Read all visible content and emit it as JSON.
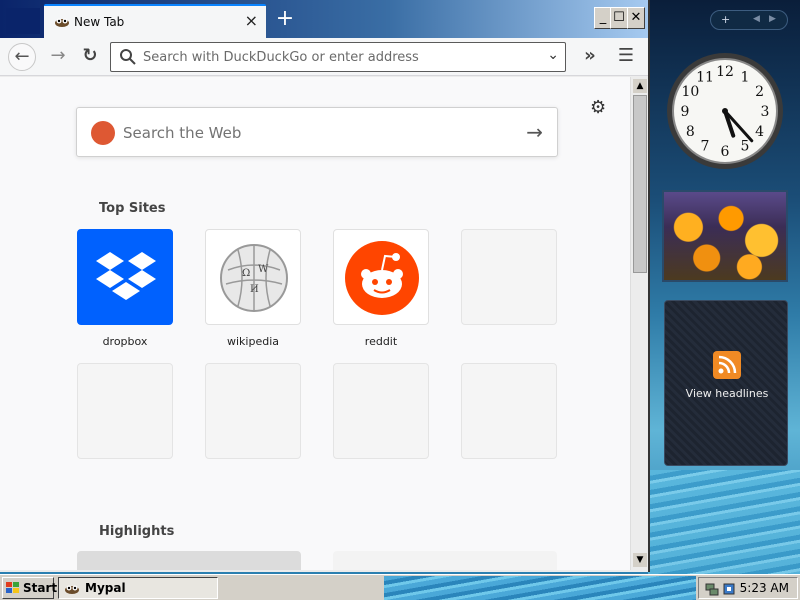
{
  "browser": {
    "tab": {
      "title": "New Tab",
      "close_glyph": "×"
    },
    "new_tab_glyph": "+",
    "window_buttons": {
      "minimize": "_",
      "maximize": "☐",
      "close": "✕"
    },
    "nav": {
      "back_glyph": "←",
      "forward_glyph": "→",
      "reload_glyph": "↻",
      "overflow_glyph": "»",
      "menu_glyph": "☰"
    },
    "url_placeholder": "Search with DuckDuckGo or enter address",
    "url_value": "",
    "url_dropdown_glyph": "⌄"
  },
  "newtab": {
    "settings_glyph": "⚙",
    "search_placeholder": "Search the Web",
    "search_arrow_glyph": "→",
    "top_sites_title": "Top Sites",
    "top_sites": [
      {
        "label": "dropbox",
        "icon": "dropbox-icon"
      },
      {
        "label": "wikipedia",
        "icon": "wikipedia-icon"
      },
      {
        "label": "reddit",
        "icon": "reddit-icon"
      },
      {
        "label": "",
        "icon": ""
      },
      {
        "label": "",
        "icon": ""
      },
      {
        "label": "",
        "icon": ""
      },
      {
        "label": "",
        "icon": ""
      },
      {
        "label": "",
        "icon": ""
      }
    ],
    "highlights_title": "Highlights"
  },
  "gadgets": {
    "bar": {
      "add": "+",
      "prev": "◀",
      "next": "▶"
    },
    "clock": {
      "hour": 5,
      "minute": 23
    },
    "feed_label": "View headlines"
  },
  "taskbar": {
    "start_label": "Start",
    "task_label": "Mypal",
    "time": "5:23 AM"
  },
  "colors": {
    "dropbox": "#0061fe",
    "reddit": "#ff4500",
    "accent": "#0a84ff"
  }
}
